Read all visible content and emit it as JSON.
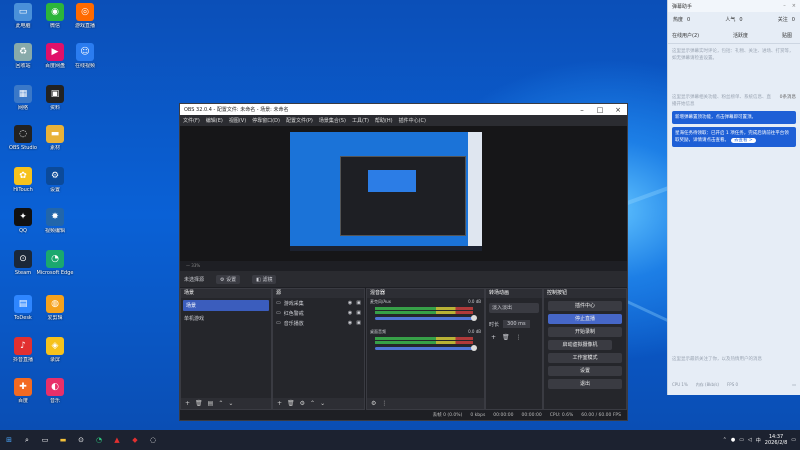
{
  "desktop": {
    "icons": [
      {
        "label": "此电脑",
        "icon": "computer-icon",
        "color": "#4a90d9",
        "glyph": "▭"
      },
      {
        "label": "微信",
        "icon": "wechat-icon",
        "color": "#2cb53a",
        "glyph": "◉"
      },
      {
        "label": "游戏直播",
        "icon": "live-icon",
        "color": "#ff6a00",
        "glyph": "◎"
      },
      {
        "label": "回收站",
        "icon": "recycle-bin-icon",
        "color": "#8aa",
        "glyph": "♻"
      },
      {
        "label": "百度网盘",
        "icon": "drive-icon",
        "color": "#e0106a",
        "glyph": "▶"
      },
      {
        "label": "在线视频",
        "icon": "video-icon",
        "color": "#2b7cf0",
        "glyph": "☺"
      },
      {
        "label": "网络",
        "icon": "network-icon",
        "color": "#3a78c8",
        "glyph": "▦"
      },
      {
        "label": "资料",
        "icon": "folder-icon",
        "color": "#222",
        "glyph": "▣"
      },
      {
        "label": "OBS Studio",
        "icon": "obs-icon",
        "color": "#222",
        "glyph": "◌"
      },
      {
        "label": "素材",
        "icon": "folder2-icon",
        "color": "#e8b23a",
        "glyph": "▬"
      },
      {
        "label": "HiTouch",
        "icon": "app-icon",
        "color": "#f6c21c",
        "glyph": "✿"
      },
      {
        "label": "设置",
        "icon": "settings-app-icon",
        "color": "#0b4a9a",
        "glyph": "⚙"
      },
      {
        "label": "QQ",
        "icon": "qq-icon",
        "color": "#111",
        "glyph": "✦"
      },
      {
        "label": "视频编辑",
        "icon": "editor-icon",
        "color": "#26a",
        "glyph": "✸"
      },
      {
        "label": "Steam",
        "icon": "steam-icon",
        "color": "#1b2838",
        "glyph": "⊙"
      },
      {
        "label": "Microsoft Edge",
        "icon": "edge-icon",
        "color": "#1aa86e",
        "glyph": "◔"
      },
      {
        "label": "ToDesk",
        "icon": "todesk-icon",
        "color": "#2e86ff",
        "glyph": "▤"
      },
      {
        "label": "爱剪辑",
        "icon": "clip-icon",
        "color": "#f6a21c",
        "glyph": "◍"
      },
      {
        "label": "抖音直播",
        "icon": "douyin-icon",
        "color": "#e23030",
        "glyph": "♪"
      },
      {
        "label": "录屏",
        "icon": "recorder-icon",
        "color": "#f6c21c",
        "glyph": "◈"
      },
      {
        "label": "百度",
        "icon": "baidu-icon",
        "color": "#f36a21",
        "glyph": "✚"
      },
      {
        "label": "音乐",
        "icon": "music-icon",
        "color": "#e8306a",
        "glyph": "◐"
      }
    ]
  },
  "obs": {
    "title": "OBS 32.0.4 - 配置文件: 未命名 - 场景: 未命名",
    "menu": [
      "文件(F)",
      "编辑(E)",
      "视图(V)",
      "停靠窗口(D)",
      "配置文件(P)",
      "场景集合(S)",
      "工具(T)",
      "帮助(H)",
      "插件中心(C)"
    ],
    "zoom": "— 33%",
    "no_source": "未选择源",
    "props_btn": "设置",
    "filters_btn": "滤镜",
    "scenes": {
      "title": "场景",
      "items": [
        "场景",
        "单机游戏"
      ]
    },
    "sources": {
      "title": "源",
      "items": [
        "游戏采集",
        "红色警戒",
        "音乐播放"
      ]
    },
    "mixer": {
      "title": "混音器",
      "channels": [
        {
          "name": "麦克风/Aux",
          "db": "0.0 dB"
        },
        {
          "name": "桌面音频",
          "db": "0.0 dB"
        }
      ]
    },
    "transitions": {
      "title": "转场动画",
      "type": "淡入淡出",
      "duration_label": "时长",
      "duration": "300 ms"
    },
    "controls": {
      "title": "控制按钮",
      "buttons": [
        "插件中心",
        "停止直播",
        "开始录制",
        "启动虚拟摄像机",
        "工作室模式",
        "设置",
        "退出"
      ]
    },
    "status": {
      "dropped": "丢帧 0 (0.0%)",
      "kbps": "0 kbps",
      "live_time": "00:00:00",
      "rec_time": "00:00:00",
      "cpu": "CPU: 0.6%",
      "fps": "60.00 / 60.00 FPS"
    }
  },
  "panel": {
    "title": "弹幕助手",
    "stats": [
      {
        "label": "热度",
        "value": "0"
      },
      {
        "label": "人气",
        "value": "0"
      },
      {
        "label": "关注",
        "value": "0"
      }
    ],
    "tabs": [
      "在线用户(2)",
      "活跃度",
      "贴图"
    ],
    "hint1": "这里显示弹幕实时评论，包括：礼物、关注、进场、打赏等，如无弹幕请检查设置。",
    "hint2": "这里显示弹幕相关功能、粉丝榜单、系统信息、直播开始信息",
    "badge": "0条消息",
    "msg1": "新增弹幕置顶功能，点击弹幕即可置顶。",
    "msg2": "星海任务待领取：已开启 1 项任务，完成后请前往平台领取奖励，详情请点击查看。",
    "msg2_link": "去查看 >",
    "hint3": "这里显示最新关注了你，以及热情用户的消息",
    "foot": [
      "CPU 1%",
      "内存 (8kb/s)",
      "FPS 0"
    ]
  },
  "taskbar": {
    "time": "14:37",
    "date": "2026/2/8"
  }
}
